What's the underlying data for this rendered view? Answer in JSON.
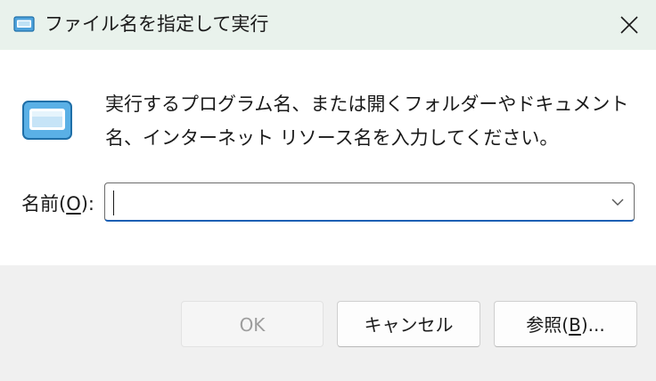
{
  "window": {
    "title": "ファイル名を指定して実行",
    "title_icon": "run-dialog-icon",
    "close_icon": "close-icon"
  },
  "main": {
    "icon": "run-dialog-icon",
    "description": "実行するプログラム名、または開くフォルダーやドキュメント名、インターネット リソース名を入力してください。"
  },
  "open_field": {
    "label_prefix": "名前(",
    "label_accel": "O",
    "label_suffix": "):",
    "value": "",
    "dropdown_icon": "chevron-down-icon"
  },
  "buttons": {
    "ok": "OK",
    "cancel": "キャンセル",
    "browse_prefix": "参照(",
    "browse_accel": "B",
    "browse_suffix": ")..."
  },
  "colors": {
    "titlebar_bg": "#e9f2ec",
    "footer_bg": "#f0f0f0",
    "focus_accent": "#1a5fb4",
    "icon_blue": "#4fa3dc"
  }
}
